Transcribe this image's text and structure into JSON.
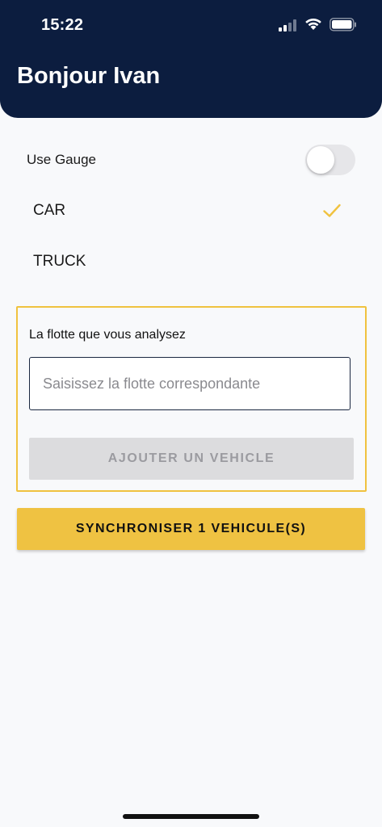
{
  "status_bar": {
    "time": "15:22",
    "signal_icon": "cellular-signal-icon",
    "wifi_icon": "wifi-icon",
    "battery_icon": "battery-icon"
  },
  "header": {
    "title": "Bonjour Ivan",
    "background_color": "#0c1d3f"
  },
  "settings": {
    "use_gauge_label": "Use Gauge",
    "use_gauge_enabled": false
  },
  "vehicle_types": [
    {
      "label": "CAR",
      "selected": true
    },
    {
      "label": "TRUCK",
      "selected": false
    }
  ],
  "fleet": {
    "label": "La flotte que vous analysez",
    "input_value": "",
    "input_placeholder": "Saisissez la flotte correspondante",
    "add_button_label": "AJOUTER UN VEHICLE",
    "add_button_disabled": true,
    "accent_color": "#f0c23f"
  },
  "sync": {
    "button_label": "SYNCHRONISER 1 VEHICULE(S)",
    "color": "#efc242"
  }
}
